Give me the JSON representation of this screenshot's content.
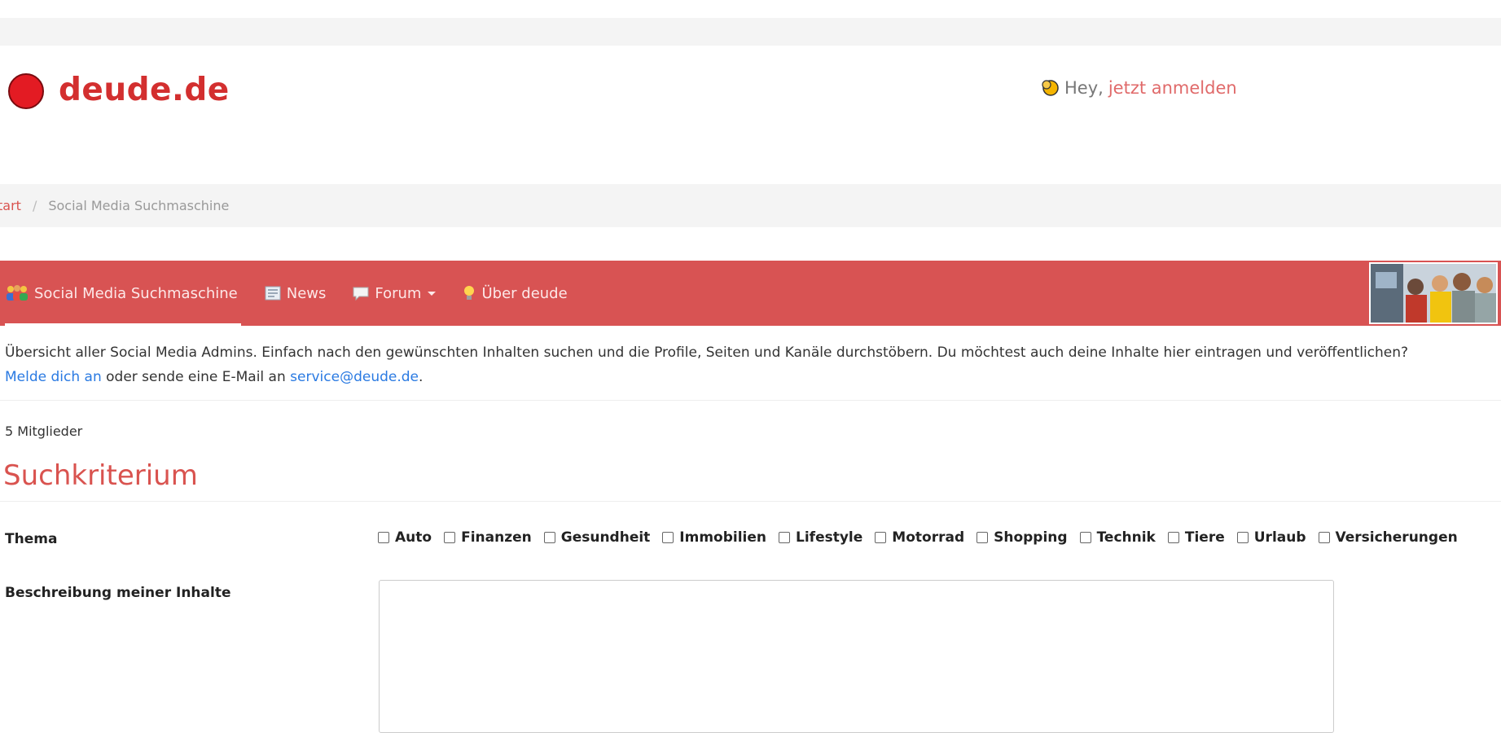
{
  "header": {
    "logo_text": "deude.de",
    "greeting": "Hey,",
    "login_link": "jetzt anmelden"
  },
  "breadcrumb": {
    "home": "tart",
    "separator": "/",
    "current": "Social Media Suchmaschine"
  },
  "nav": {
    "items": [
      {
        "label": "Social Media Suchmaschine",
        "icon": "people-icon"
      },
      {
        "label": "News",
        "icon": "newspaper-icon"
      },
      {
        "label": "Forum",
        "icon": "speech-bubble-icon"
      },
      {
        "label": "Über deude",
        "icon": "lightbulb-icon"
      }
    ]
  },
  "intro": {
    "text": "Übersicht aller Social Media Admins. Einfach nach den gewünschten Inhalten suchen und die Profile, Seiten und Kanäle durchstöbern. Du möchtest auch deine Inhalte hier eintragen und veröffentlichen?",
    "signup_link": "Melde dich an",
    "middle_text": "oder sende eine E-Mail an",
    "email_link": "service@deude.de",
    "end": "."
  },
  "members_count": "5 Mitglieder",
  "section_title": "Suchkriterium",
  "form": {
    "topic_label": "Thema",
    "topics": [
      "Auto",
      "Finanzen",
      "Gesundheit",
      "Immobilien",
      "Lifestyle",
      "Motorrad",
      "Shopping",
      "Technik",
      "Tiere",
      "Urlaub",
      "Versicherungen"
    ],
    "description_label": "Beschreibung meiner Inhalte",
    "description_value": ""
  },
  "colors": {
    "brand_red": "#d32f2f",
    "nav_bg": "#d85353",
    "link_blue": "#2a7ae2"
  }
}
